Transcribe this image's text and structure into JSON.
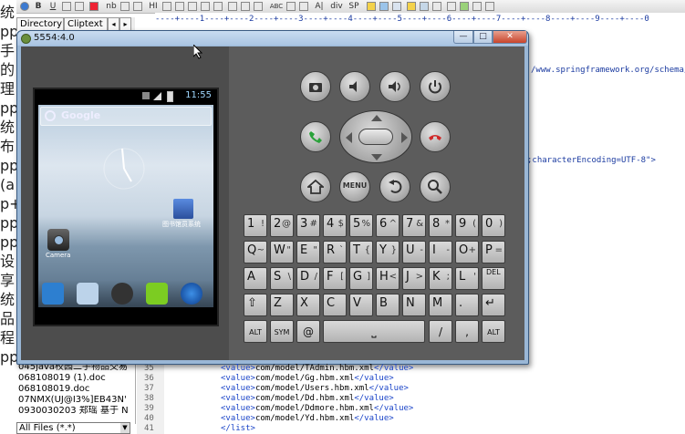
{
  "left_strip": {
    "chars": [
      "统",
      "pp",
      "手",
      "的",
      "理",
      "pp",
      "统",
      "布",
      "pp",
      "(a",
      "p+",
      "pp",
      "pp",
      "设",
      "享",
      "统",
      "品",
      "程",
      "pp"
    ]
  },
  "editor": {
    "toolbar_labels": [
      "B",
      "U",
      "nb",
      "HI",
      "ABC",
      "A|",
      "div",
      "SP"
    ],
    "tabs": [
      "Directory",
      "Cliptext"
    ],
    "ruler": "----+----1----+----2----+----3----+----4----+----5----+----6----+----7----+----8----+----9----+----0",
    "code_right_1": "/www.springframework.org/schema/",
    "code_right_2": ";characterEncoding=UTF-8\">",
    "files": [
      "045java校园二手物品交易",
      "068108019 (1).doc",
      "068108019.doc",
      "07NMX(UJ@I3%]EB43N'",
      "0930030203 郑瑶 基于 N"
    ],
    "file_filter": "All Files (*.*)",
    "line_numbers": [
      "35",
      "36",
      "37",
      "38",
      "39",
      "40",
      "41"
    ],
    "xml_lines": [
      {
        "open": "<value>",
        "text": "com/model/TAdmin.hbm.xml",
        "close": "</value>"
      },
      {
        "open": "<value>",
        "text": "com/model/Gg.hbm.xml",
        "close": "</value>"
      },
      {
        "open": "<value>",
        "text": "com/model/Users.hbm.xml",
        "close": "</value>"
      },
      {
        "open": "<value>",
        "text": "com/model/Dd.hbm.xml",
        "close": "</value>"
      },
      {
        "open": "<value>",
        "text": "com/model/Ddmore.hbm.xml",
        "close": "</value>"
      },
      {
        "open": "<value>",
        "text": "com/model/Yd.hbm.xml",
        "close": "</value>"
      },
      {
        "open": "</list>",
        "text": "",
        "close": ""
      }
    ]
  },
  "emulator": {
    "title": "5554:4.0",
    "window_buttons": {
      "min": "—",
      "max": "□",
      "close": "✕"
    },
    "phone": {
      "time": "11:55",
      "search_label": "Google",
      "widget_label": "图书馆员系统",
      "camera_label": "Camera"
    },
    "keyboard": {
      "row1": [
        [
          "1",
          "!"
        ],
        [
          "2",
          "@"
        ],
        [
          "3",
          "#"
        ],
        [
          "4",
          "$"
        ],
        [
          "5",
          "%"
        ],
        [
          "6",
          "^"
        ],
        [
          "7",
          "&"
        ],
        [
          "8",
          "*"
        ],
        [
          "9",
          "("
        ],
        [
          "0",
          ")"
        ]
      ],
      "row2": [
        [
          "Q",
          "~"
        ],
        [
          "W",
          "\""
        ],
        [
          "E",
          "\""
        ],
        [
          "R",
          "`"
        ],
        [
          "T",
          "{"
        ],
        [
          "Y",
          "}"
        ],
        [
          "U",
          "-"
        ],
        [
          "I",
          "-"
        ],
        [
          "O",
          "+"
        ],
        [
          "P",
          "="
        ]
      ],
      "row3": [
        [
          "A",
          ""
        ],
        [
          "S",
          "\\"
        ],
        [
          "D",
          "/"
        ],
        [
          "F",
          "["
        ],
        [
          "G",
          "]"
        ],
        [
          "H",
          "<"
        ],
        [
          "J",
          ">"
        ],
        [
          "K",
          ";"
        ],
        [
          "L",
          "'"
        ],
        [
          "DEL",
          ""
        ]
      ],
      "row4": [
        [
          "⇧",
          ""
        ],
        [
          "Z",
          ""
        ],
        [
          "X",
          ""
        ],
        [
          "C",
          ""
        ],
        [
          "V",
          ""
        ],
        [
          "B",
          ""
        ],
        [
          "N",
          ""
        ],
        [
          "M",
          ""
        ],
        [
          ".",
          ""
        ],
        [
          "↵",
          ""
        ]
      ],
      "row5_alt": "ALT",
      "row5_sym": "SYM",
      "row5_at": "@",
      "row5_slash": "/",
      "row5_question": "?",
      "row5_comma": ",",
      "row5_alt2": "ALT",
      "menu_label": "MENU"
    }
  },
  "colors": {
    "call": "#2aa23a",
    "end": "#d02828",
    "titlebar": "#a9c4e2"
  }
}
